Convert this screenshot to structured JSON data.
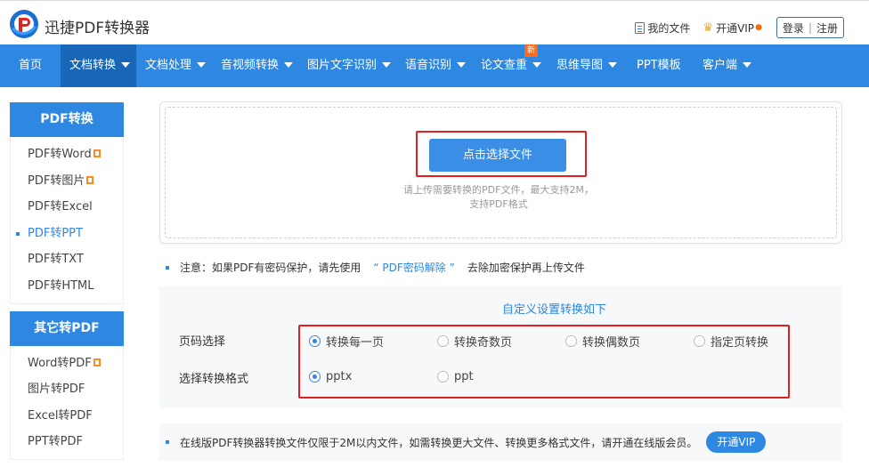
{
  "header": {
    "brand": "迅捷PDF转换器",
    "my_files": "我的文件",
    "vip": "开通VIP",
    "login": "登录",
    "separator": "|",
    "register": "注册"
  },
  "nav": {
    "items": [
      {
        "label": "首页",
        "caret": false
      },
      {
        "label": "文档转换",
        "caret": true,
        "active": true
      },
      {
        "label": "文档处理",
        "caret": true
      },
      {
        "label": "音视频转换",
        "caret": true
      },
      {
        "label": "图片文字识别",
        "caret": true
      },
      {
        "label": "语音识别",
        "caret": true
      },
      {
        "label": "论文查重",
        "caret": true,
        "badge": "新"
      },
      {
        "label": "思维导图",
        "caret": true
      },
      {
        "label": "PPT模板",
        "caret": false
      },
      {
        "label": "客户端",
        "caret": true
      }
    ]
  },
  "sidebar": {
    "group1_title": "PDF转换",
    "group1_items": [
      "PDF转Word",
      "PDF转图片",
      "PDF转Excel",
      "PDF转PPT",
      "PDF转TXT",
      "PDF转HTML"
    ],
    "group2_title": "其它转PDF",
    "group2_items": [
      "Word转PDF",
      "图片转PDF",
      "Excel转PDF",
      "PPT转PDF"
    ]
  },
  "upload": {
    "button": "点击选择文件",
    "hint_line1": "请上传需要转换的PDF文件，最大支持2M，",
    "hint_line2": "支持PDF格式"
  },
  "note": {
    "prefix": "注意：如果PDF有密码保护，请先使用",
    "link": "“ PDF密码解除 ”",
    "suffix": "去除加密保护再上传文件"
  },
  "settings": {
    "title": "自定义设置转换如下",
    "page_label": "页码选择",
    "page_options": [
      "转换每一页",
      "转换奇数页",
      "转换偶数页",
      "指定页转换"
    ],
    "page_selected": "转换每一页",
    "format_label": "选择转换格式",
    "format_options": [
      "pptx",
      "ppt"
    ],
    "format_selected": "pptx"
  },
  "bottom": {
    "text": "在线版PDF转换器转换文件仅限于2M以内文件，如需转换更大文件、转换更多格式文件，请开通在线版会员。",
    "vip_button": "开通VIP"
  },
  "colors": {
    "primary": "#2e87e0",
    "nav_active": "#1766b8",
    "highlight_border": "#e02020"
  }
}
